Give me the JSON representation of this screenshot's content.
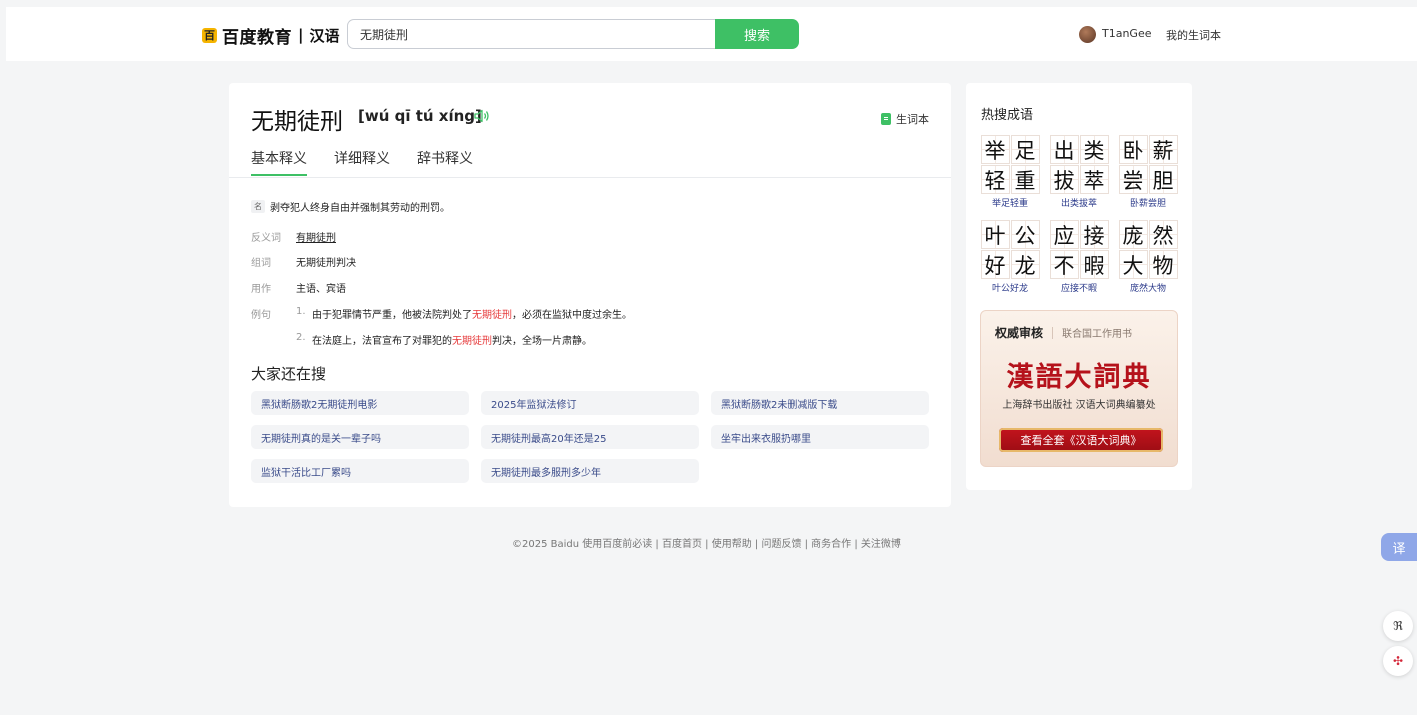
{
  "header": {
    "logo_badge": "百",
    "logo_text": "百度教育",
    "logo_sep": "|",
    "logo_sub": "汉语",
    "search_value": "无期徒刑",
    "search_button": "搜索",
    "user_name": "T1anGee",
    "user_vocab": "我的生词本"
  },
  "entry": {
    "word": "无期徒刑",
    "pinyin": "[wú qī tú xíng]",
    "vocab_button": "生词本",
    "tabs": [
      "基本释义",
      "详细释义",
      "辞书释义"
    ],
    "pos_tag": "名",
    "definition": "剥夺犯人终身自由并强制其劳动的刑罚。",
    "antonym_label": "反义词",
    "antonym_value": "有期徒刑",
    "phrase_label": "组词",
    "phrase_value": "无期徒刑判决",
    "usage_label": "用作",
    "usage_value": "主语、宾语",
    "example_label": "例句",
    "examples": [
      {
        "num": "1.",
        "before": "由于犯罪情节严重，他被法院判处了",
        "hl": "无期徒刑",
        "after": "，必须在监狱中度过余生。"
      },
      {
        "num": "2.",
        "before": "在法庭上，法官宣布了对罪犯的",
        "hl": "无期徒刑",
        "after": "判决，全场一片肃静。"
      }
    ]
  },
  "also_search": {
    "title": "大家还在搜",
    "items": [
      "黑狱断肠歌2无期徒刑电影",
      "2025年监狱法修订",
      "黑狱断肠歌2未删减版下载",
      "无期徒刑真的是关一辈子吗",
      "无期徒刑最高20年还是25",
      "坐牢出来衣服扔哪里",
      "监狱干活比工厂累吗",
      "无期徒刑最多服刑多少年"
    ]
  },
  "footer": {
    "text": "©2025 Baidu  使用百度前必读 | 百度首页 | 使用帮助 | 问题反馈 | 商务合作 | 关注微博"
  },
  "sidebar": {
    "title": "热搜成语",
    "idioms": [
      {
        "chars": [
          "举",
          "足",
          "轻",
          "重"
        ],
        "label": "举足轻重"
      },
      {
        "chars": [
          "出",
          "类",
          "拔",
          "萃"
        ],
        "label": "出类拔萃"
      },
      {
        "chars": [
          "卧",
          "薪",
          "尝",
          "胆"
        ],
        "label": "卧薪尝胆"
      },
      {
        "chars": [
          "叶",
          "公",
          "好",
          "龙"
        ],
        "label": "叶公好龙"
      },
      {
        "chars": [
          "应",
          "接",
          "不",
          "暇"
        ],
        "label": "应接不暇"
      },
      {
        "chars": [
          "庞",
          "然",
          "大",
          "物"
        ],
        "label": "庞然大物"
      }
    ],
    "promo": {
      "head_bold": "权威审核",
      "head_sub": "联合国工作用书",
      "big": "漢語大詞典",
      "sub": "上海辞书出版社  汉语大词典编纂处",
      "button": "查看全套《汉语大词典》"
    }
  },
  "tools": {
    "translate": "译",
    "tool2": "ℜ",
    "tool3": "✣"
  },
  "colors": {
    "accent_green": "#3ec065",
    "highlight_red": "#e6393a",
    "promo_red": "#b5121b"
  }
}
